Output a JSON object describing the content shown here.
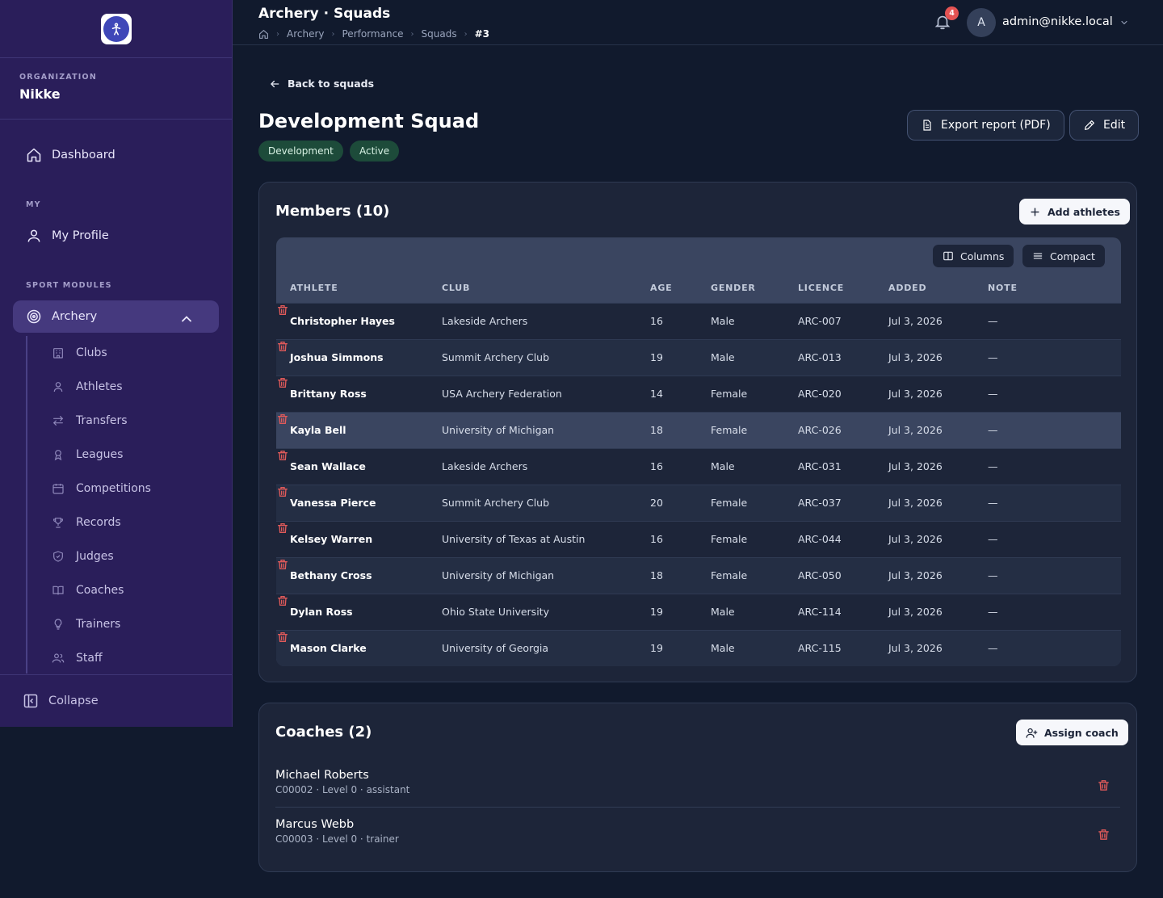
{
  "sidebar": {
    "org_label": "ORGANIZATION",
    "org_name": "Nikke",
    "dashboard": "Dashboard",
    "my_section": "MY",
    "my_profile": "My Profile",
    "sport_section": "SPORT MODULES",
    "archery": "Archery",
    "sub": {
      "clubs": "Clubs",
      "athletes": "Athletes",
      "transfers": "Transfers",
      "leagues": "Leagues",
      "competitions": "Competitions",
      "records": "Records",
      "judges": "Judges",
      "coaches": "Coaches",
      "trainers": "Trainers",
      "staff": "Staff"
    },
    "collapse": "Collapse"
  },
  "header": {
    "title": "Archery · Squads",
    "breadcrumbs": [
      "Archery",
      "Performance",
      "Squads",
      "#3"
    ],
    "notification_count": "4",
    "avatar_initial": "A",
    "user_email": "admin@nikke.local"
  },
  "page": {
    "back": "Back to squads",
    "title": "Development Squad",
    "tags": [
      "Development",
      "Active"
    ],
    "export_btn": "Export report (PDF)",
    "edit_btn": "Edit"
  },
  "members": {
    "title": "Members (10)",
    "add_btn": "Add athletes",
    "columns_btn": "Columns",
    "compact_btn": "Compact",
    "headers": [
      "ATHLETE",
      "CLUB",
      "AGE",
      "GENDER",
      "LICENCE",
      "ADDED",
      "NOTE"
    ],
    "rows": [
      {
        "athlete": "Christopher Hayes",
        "club": "Lakeside Archers",
        "age": "16",
        "gender": "Male",
        "licence": "ARC-007",
        "added": "Jul 3, 2026",
        "note": "—"
      },
      {
        "athlete": "Joshua Simmons",
        "club": "Summit Archery Club",
        "age": "19",
        "gender": "Male",
        "licence": "ARC-013",
        "added": "Jul 3, 2026",
        "note": "—"
      },
      {
        "athlete": "Brittany Ross",
        "club": "USA Archery Federation",
        "age": "14",
        "gender": "Female",
        "licence": "ARC-020",
        "added": "Jul 3, 2026",
        "note": "—"
      },
      {
        "athlete": "Kayla Bell",
        "club": "University of Michigan",
        "age": "18",
        "gender": "Female",
        "licence": "ARC-026",
        "added": "Jul 3, 2026",
        "note": "—"
      },
      {
        "athlete": "Sean Wallace",
        "club": "Lakeside Archers",
        "age": "16",
        "gender": "Male",
        "licence": "ARC-031",
        "added": "Jul 3, 2026",
        "note": "—"
      },
      {
        "athlete": "Vanessa Pierce",
        "club": "Summit Archery Club",
        "age": "20",
        "gender": "Female",
        "licence": "ARC-037",
        "added": "Jul 3, 2026",
        "note": "—"
      },
      {
        "athlete": "Kelsey Warren",
        "club": "University of Texas at Austin",
        "age": "16",
        "gender": "Female",
        "licence": "ARC-044",
        "added": "Jul 3, 2026",
        "note": "—"
      },
      {
        "athlete": "Bethany Cross",
        "club": "University of Michigan",
        "age": "18",
        "gender": "Female",
        "licence": "ARC-050",
        "added": "Jul 3, 2026",
        "note": "—"
      },
      {
        "athlete": "Dylan Ross",
        "club": "Ohio State University",
        "age": "19",
        "gender": "Male",
        "licence": "ARC-114",
        "added": "Jul 3, 2026",
        "note": "—"
      },
      {
        "athlete": "Mason Clarke",
        "club": "University of Georgia",
        "age": "19",
        "gender": "Male",
        "licence": "ARC-115",
        "added": "Jul 3, 2026",
        "note": "—"
      }
    ]
  },
  "coaches": {
    "title": "Coaches (2)",
    "assign_btn": "Assign coach",
    "items": [
      {
        "name": "Michael Roberts",
        "meta": "C00002 · Level 0 · assistant"
      },
      {
        "name": "Marcus Webb",
        "meta": "C00003 · Level 0 · trainer"
      }
    ]
  },
  "colors": {
    "sidebar_bg": "#2a1e5a",
    "page_bg": "#111a2d",
    "card_bg": "#1d2539",
    "tag_bg": "#1d4b3a",
    "delete_red": "#e05a5a",
    "badge_red": "#e55353"
  }
}
